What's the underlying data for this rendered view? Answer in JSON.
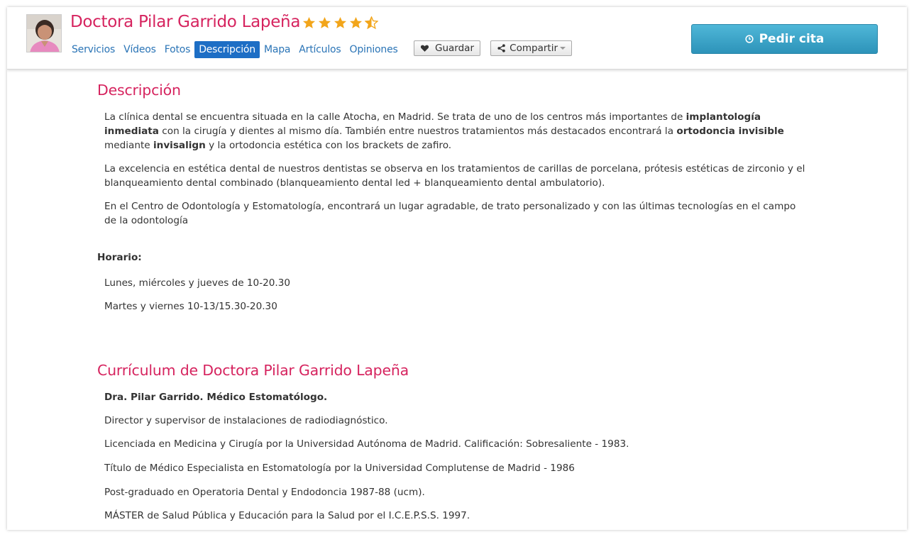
{
  "header": {
    "doctor_name": "Doctora Pilar Garrido Lapeña",
    "rating": 4.5,
    "rating_max": 5,
    "nav": [
      "Servicios",
      "Vídeos",
      "Fotos",
      "Descripción",
      "Mapa",
      "Artículos",
      "Opiniones"
    ],
    "active_nav": "Descripción",
    "save_label": "Guardar",
    "share_label": "Compartir",
    "cta_label": "Pedir cita"
  },
  "description": {
    "heading": "Descripción",
    "p1": {
      "t1": "La clínica dental se encuentra situada en la calle Atocha, en Madrid. Se trata de uno de los centros más importantes de ",
      "b1": "implantología inmediata",
      "t2": " con la cirugía y dientes al mismo día. También entre nuestros tratamientos más destacados encontrará la ",
      "b2": "ortodoncia invisible",
      "t3": " mediante ",
      "b3": "invisalign",
      "t4": " y la ortodoncia estética con los brackets de zafiro."
    },
    "p2": "La excelencia en estética dental de nuestros dentistas se observa en los tratamientos de carillas de porcelana, prótesis estéticas de zirconio y el blanqueamiento dental combinado (blanqueamiento dental led + blanqueamiento dental ambulatorio).",
    "p3": "En el Centro de Odontología y Estomatología, encontrará un lugar agradable, de trato personalizado y con las últimas tecnologías en el campo de la odontología",
    "schedule_label": "Horario:",
    "schedule": [
      "Lunes, miércoles y jueves de 10-20.30",
      "Martes y viernes 10-13/15.30-20.30"
    ]
  },
  "curriculum": {
    "heading": "Currículum de Doctora Pilar Garrido Lapeña",
    "title_line": "Dra. Pilar Garrido. Médico Estomatólogo.",
    "items": [
      "Director y supervisor de instalaciones de radiodiagnóstico.",
      "Licenciada en Medicina y Cirugía por la Universidad Autónoma de Madrid. Calificación: Sobresaliente - 1983.",
      "Título de Médico Especialista en Estomatología por la Universidad Complutense de Madrid - 1986",
      "Post-graduado en Operatoria Dental y Endodoncia 1987-88 (ucm).",
      "MÁSTER de Salud Pública y Educación para la Salud por el I.C.E.P.S.S. 1997."
    ]
  },
  "colors": {
    "accent": "#d6245f",
    "link": "#2a74b6",
    "active_nav_bg": "#1d6ec5",
    "cta": "#3aa3c8",
    "star": "#f2a51a"
  },
  "icons": [
    "avatar-photo",
    "star-icon",
    "heart-icon",
    "share-icon",
    "clock-icon",
    "chevron-down-icon"
  ]
}
